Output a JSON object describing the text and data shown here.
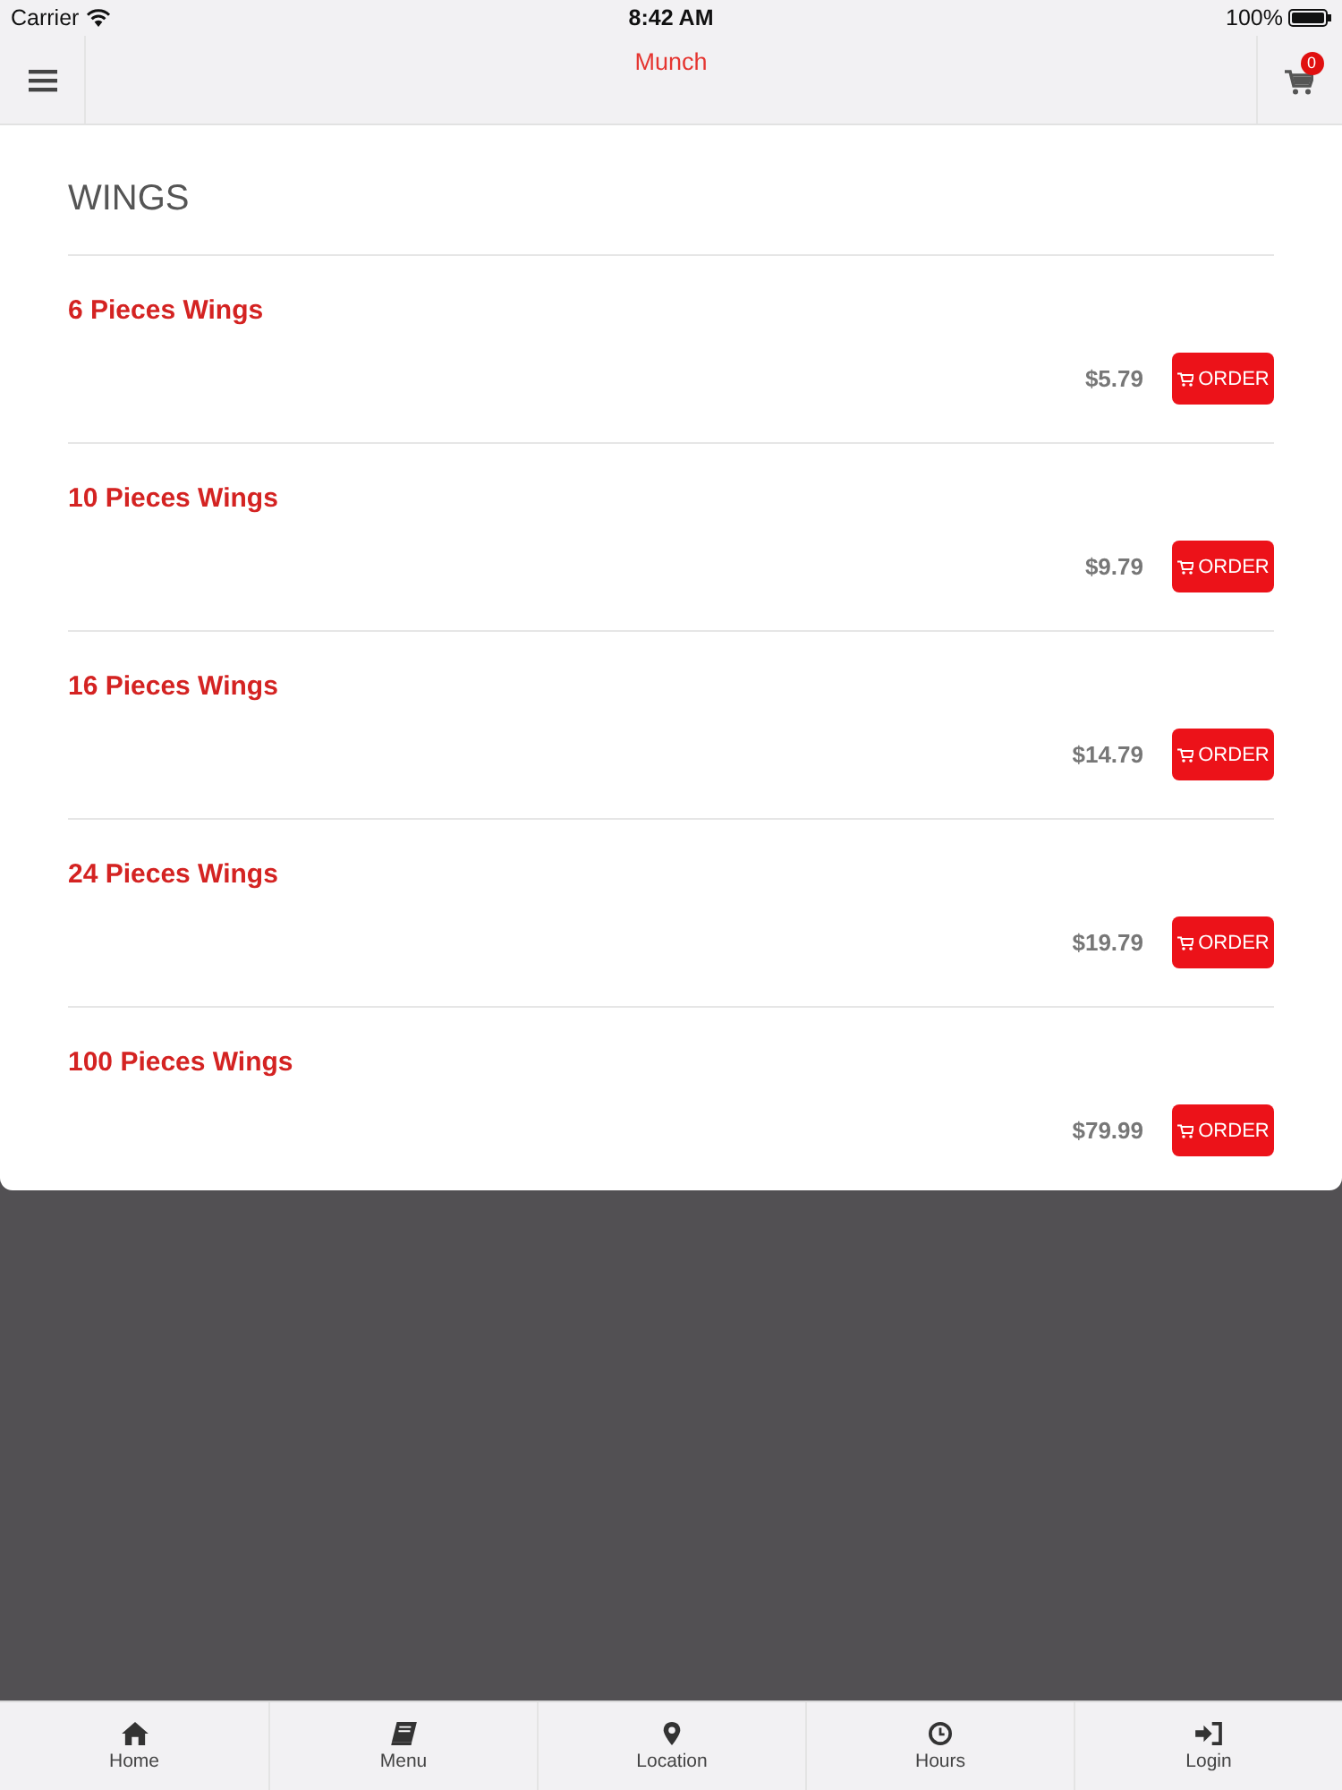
{
  "status_bar": {
    "carrier": "Carrier",
    "time": "8:42 AM",
    "battery": "100%"
  },
  "nav_bar": {
    "title": "Munch",
    "cart_count": "0"
  },
  "section": {
    "title": "WINGS",
    "items": [
      {
        "name": "6 Pieces Wings",
        "price": "$5.79",
        "button": "ORDER"
      },
      {
        "name": "10 Pieces Wings",
        "price": "$9.79",
        "button": "ORDER"
      },
      {
        "name": "16 Pieces Wings",
        "price": "$14.79",
        "button": "ORDER"
      },
      {
        "name": "24 Pieces Wings",
        "price": "$19.79",
        "button": "ORDER"
      },
      {
        "name": "100 Pieces Wings",
        "price": "$79.99",
        "button": "ORDER"
      }
    ]
  },
  "tab_bar": {
    "tabs": [
      {
        "label": "Home"
      },
      {
        "label": "Menu"
      },
      {
        "label": "Location"
      },
      {
        "label": "Hours"
      },
      {
        "label": "Login"
      }
    ]
  }
}
